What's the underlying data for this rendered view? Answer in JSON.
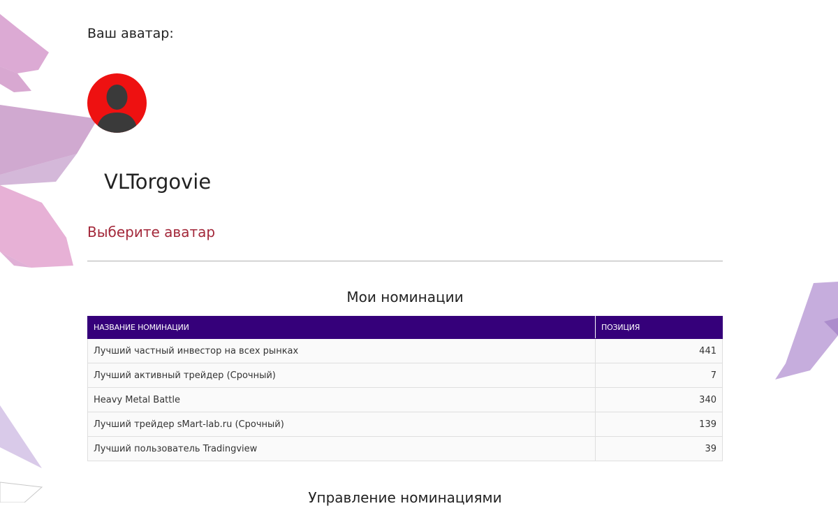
{
  "profile": {
    "avatar_heading": "Ваш аватар:",
    "username": "VLTorgovie",
    "choose_avatar_link": "Выберите аватар"
  },
  "nominations": {
    "title": "Мои номинации",
    "columns": [
      "НАЗВАНИЕ НОМИНАЦИИ",
      "ПОЗИЦИЯ"
    ],
    "rows": [
      {
        "name": "Лучший частный инвестор на всех рынках",
        "position": "441"
      },
      {
        "name": "Лучший активный трейдер (Срочный)",
        "position": "7"
      },
      {
        "name": "Heavy Metal Battle",
        "position": "340"
      },
      {
        "name": "Лучший трейдер sMart-lab.ru (Срочный)",
        "position": "139"
      },
      {
        "name": "Лучший пользователь Tradingview",
        "position": "39"
      }
    ]
  },
  "management": {
    "title": "Управление номинациями"
  },
  "colors": {
    "table_header_bg": "#35007a",
    "link": "#a3283a",
    "avatar_bg": "#ee1111"
  },
  "icons": {
    "avatar": "user-silhouette-icon"
  }
}
